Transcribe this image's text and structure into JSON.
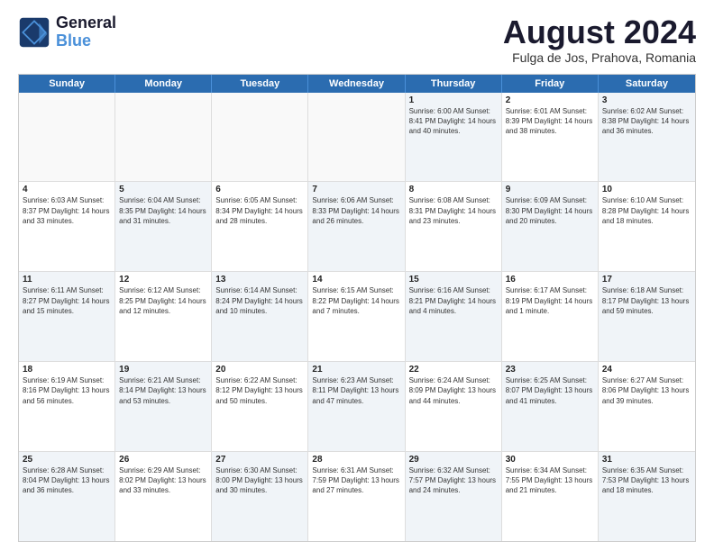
{
  "header": {
    "logo_line1": "General",
    "logo_line2": "Blue",
    "month_title": "August 2024",
    "location": "Fulga de Jos, Prahova, Romania"
  },
  "day_headers": [
    "Sunday",
    "Monday",
    "Tuesday",
    "Wednesday",
    "Thursday",
    "Friday",
    "Saturday"
  ],
  "weeks": [
    [
      {
        "day": "",
        "info": "",
        "empty": true
      },
      {
        "day": "",
        "info": "",
        "empty": true
      },
      {
        "day": "",
        "info": "",
        "empty": true
      },
      {
        "day": "",
        "info": "",
        "empty": true
      },
      {
        "day": "1",
        "info": "Sunrise: 6:00 AM\nSunset: 8:41 PM\nDaylight: 14 hours\nand 40 minutes.",
        "shaded": true
      },
      {
        "day": "2",
        "info": "Sunrise: 6:01 AM\nSunset: 8:39 PM\nDaylight: 14 hours\nand 38 minutes.",
        "shaded": false
      },
      {
        "day": "3",
        "info": "Sunrise: 6:02 AM\nSunset: 8:38 PM\nDaylight: 14 hours\nand 36 minutes.",
        "shaded": true
      }
    ],
    [
      {
        "day": "4",
        "info": "Sunrise: 6:03 AM\nSunset: 8:37 PM\nDaylight: 14 hours\nand 33 minutes.",
        "shaded": false
      },
      {
        "day": "5",
        "info": "Sunrise: 6:04 AM\nSunset: 8:35 PM\nDaylight: 14 hours\nand 31 minutes.",
        "shaded": true
      },
      {
        "day": "6",
        "info": "Sunrise: 6:05 AM\nSunset: 8:34 PM\nDaylight: 14 hours\nand 28 minutes.",
        "shaded": false
      },
      {
        "day": "7",
        "info": "Sunrise: 6:06 AM\nSunset: 8:33 PM\nDaylight: 14 hours\nand 26 minutes.",
        "shaded": true
      },
      {
        "day": "8",
        "info": "Sunrise: 6:08 AM\nSunset: 8:31 PM\nDaylight: 14 hours\nand 23 minutes.",
        "shaded": false
      },
      {
        "day": "9",
        "info": "Sunrise: 6:09 AM\nSunset: 8:30 PM\nDaylight: 14 hours\nand 20 minutes.",
        "shaded": true
      },
      {
        "day": "10",
        "info": "Sunrise: 6:10 AM\nSunset: 8:28 PM\nDaylight: 14 hours\nand 18 minutes.",
        "shaded": false
      }
    ],
    [
      {
        "day": "11",
        "info": "Sunrise: 6:11 AM\nSunset: 8:27 PM\nDaylight: 14 hours\nand 15 minutes.",
        "shaded": true
      },
      {
        "day": "12",
        "info": "Sunrise: 6:12 AM\nSunset: 8:25 PM\nDaylight: 14 hours\nand 12 minutes.",
        "shaded": false
      },
      {
        "day": "13",
        "info": "Sunrise: 6:14 AM\nSunset: 8:24 PM\nDaylight: 14 hours\nand 10 minutes.",
        "shaded": true
      },
      {
        "day": "14",
        "info": "Sunrise: 6:15 AM\nSunset: 8:22 PM\nDaylight: 14 hours\nand 7 minutes.",
        "shaded": false
      },
      {
        "day": "15",
        "info": "Sunrise: 6:16 AM\nSunset: 8:21 PM\nDaylight: 14 hours\nand 4 minutes.",
        "shaded": true
      },
      {
        "day": "16",
        "info": "Sunrise: 6:17 AM\nSunset: 8:19 PM\nDaylight: 14 hours\nand 1 minute.",
        "shaded": false
      },
      {
        "day": "17",
        "info": "Sunrise: 6:18 AM\nSunset: 8:17 PM\nDaylight: 13 hours\nand 59 minutes.",
        "shaded": true
      }
    ],
    [
      {
        "day": "18",
        "info": "Sunrise: 6:19 AM\nSunset: 8:16 PM\nDaylight: 13 hours\nand 56 minutes.",
        "shaded": false
      },
      {
        "day": "19",
        "info": "Sunrise: 6:21 AM\nSunset: 8:14 PM\nDaylight: 13 hours\nand 53 minutes.",
        "shaded": true
      },
      {
        "day": "20",
        "info": "Sunrise: 6:22 AM\nSunset: 8:12 PM\nDaylight: 13 hours\nand 50 minutes.",
        "shaded": false
      },
      {
        "day": "21",
        "info": "Sunrise: 6:23 AM\nSunset: 8:11 PM\nDaylight: 13 hours\nand 47 minutes.",
        "shaded": true
      },
      {
        "day": "22",
        "info": "Sunrise: 6:24 AM\nSunset: 8:09 PM\nDaylight: 13 hours\nand 44 minutes.",
        "shaded": false
      },
      {
        "day": "23",
        "info": "Sunrise: 6:25 AM\nSunset: 8:07 PM\nDaylight: 13 hours\nand 41 minutes.",
        "shaded": true
      },
      {
        "day": "24",
        "info": "Sunrise: 6:27 AM\nSunset: 8:06 PM\nDaylight: 13 hours\nand 39 minutes.",
        "shaded": false
      }
    ],
    [
      {
        "day": "25",
        "info": "Sunrise: 6:28 AM\nSunset: 8:04 PM\nDaylight: 13 hours\nand 36 minutes.",
        "shaded": true
      },
      {
        "day": "26",
        "info": "Sunrise: 6:29 AM\nSunset: 8:02 PM\nDaylight: 13 hours\nand 33 minutes.",
        "shaded": false
      },
      {
        "day": "27",
        "info": "Sunrise: 6:30 AM\nSunset: 8:00 PM\nDaylight: 13 hours\nand 30 minutes.",
        "shaded": true
      },
      {
        "day": "28",
        "info": "Sunrise: 6:31 AM\nSunset: 7:59 PM\nDaylight: 13 hours\nand 27 minutes.",
        "shaded": false
      },
      {
        "day": "29",
        "info": "Sunrise: 6:32 AM\nSunset: 7:57 PM\nDaylight: 13 hours\nand 24 minutes.",
        "shaded": true
      },
      {
        "day": "30",
        "info": "Sunrise: 6:34 AM\nSunset: 7:55 PM\nDaylight: 13 hours\nand 21 minutes.",
        "shaded": false
      },
      {
        "day": "31",
        "info": "Sunrise: 6:35 AM\nSunset: 7:53 PM\nDaylight: 13 hours\nand 18 minutes.",
        "shaded": true
      }
    ]
  ]
}
